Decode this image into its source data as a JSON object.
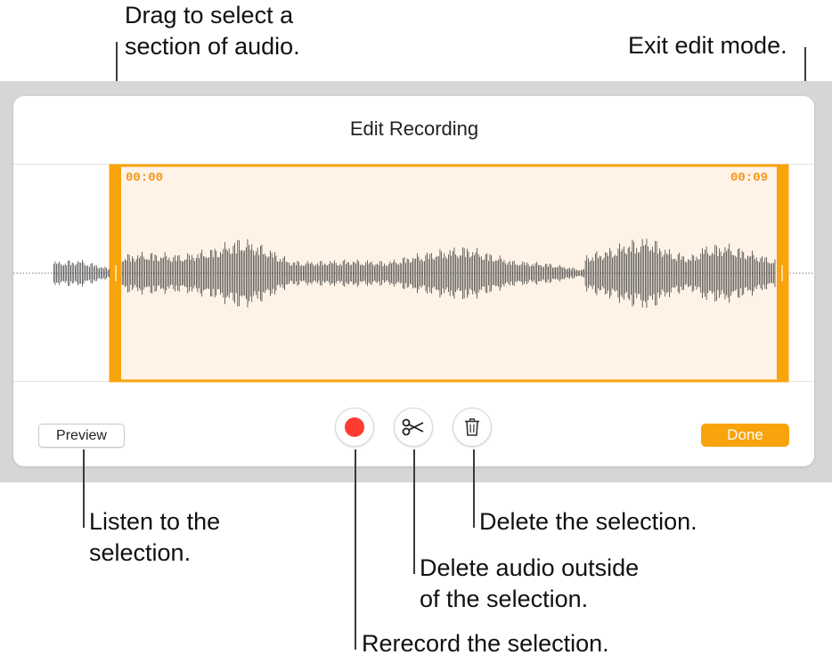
{
  "dialog": {
    "title": "Edit Recording",
    "start_time": "00:00",
    "end_time": "00:09",
    "accent_color": "#f9a30d"
  },
  "buttons": {
    "preview_label": "Preview",
    "done_label": "Done",
    "record_icon": "record-icon",
    "scissors_icon": "scissors-icon",
    "trash_icon": "trash-icon"
  },
  "callouts": {
    "drag": [
      "Drag to select a",
      "section of audio."
    ],
    "exit": [
      "Exit edit mode."
    ],
    "listen": [
      "Listen to the",
      "selection."
    ],
    "delete_selection": [
      "Delete the selection."
    ],
    "trim": [
      "Delete audio outside",
      "of the selection."
    ],
    "rerecord": [
      "Rerecord the selection."
    ]
  }
}
